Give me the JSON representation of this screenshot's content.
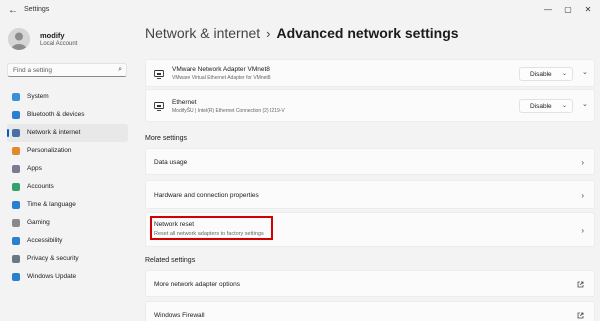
{
  "window": {
    "title": "Settings",
    "back_glyph": "←",
    "minimize_glyph": "—",
    "maximize_glyph": "▢",
    "close_glyph": "✕"
  },
  "profile": {
    "name": "modify",
    "account_type": "Local Account"
  },
  "search": {
    "placeholder": "Find a setting"
  },
  "nav": [
    {
      "label": "System",
      "icon": "monitor-icon",
      "color": "#3a8fd9"
    },
    {
      "label": "Bluetooth & devices",
      "icon": "bluetooth-icon",
      "color": "#2b7fd1"
    },
    {
      "label": "Network & internet",
      "icon": "wifi-icon",
      "color": "#4a6fa5",
      "active": true
    },
    {
      "label": "Personalization",
      "icon": "brush-icon",
      "color": "#e08a2b"
    },
    {
      "label": "Apps",
      "icon": "apps-icon",
      "color": "#7a7a90"
    },
    {
      "label": "Accounts",
      "icon": "person-icon",
      "color": "#2fa36b"
    },
    {
      "label": "Time & language",
      "icon": "globe-clock-icon",
      "color": "#2b7fd1"
    },
    {
      "label": "Gaming",
      "icon": "gamepad-icon",
      "color": "#8a8a8a"
    },
    {
      "label": "Accessibility",
      "icon": "accessibility-icon",
      "color": "#2b7fd1"
    },
    {
      "label": "Privacy & security",
      "icon": "shield-icon",
      "color": "#6c7785"
    },
    {
      "label": "Windows Update",
      "icon": "refresh-icon",
      "color": "#2b7fd1"
    }
  ],
  "breadcrumb": {
    "parent": "Network & internet",
    "separator": "›",
    "current": "Advanced network settings"
  },
  "adapters": [
    {
      "name": "VMware Network Adapter VMnet8",
      "description": "VMware Virtual Ethernet Adapter for VMnet8",
      "action": "Disable"
    },
    {
      "name": "Ethernet",
      "description": "ModifyŠU | Intel(R) Ethernet Connection (2) I219-V",
      "action": "Disable"
    }
  ],
  "more_settings": {
    "heading": "More settings",
    "items": [
      {
        "title": "Data usage"
      },
      {
        "title": "Hardware and connection properties"
      },
      {
        "title": "Network reset",
        "subtitle": "Reset all network adapters to factory settings"
      }
    ]
  },
  "related_settings": {
    "heading": "Related settings",
    "items": [
      {
        "title": "More network adapter options"
      },
      {
        "title": "Windows Firewall"
      }
    ]
  },
  "colors": {
    "accent": "#005fb8",
    "highlight_box": "#d40000"
  }
}
